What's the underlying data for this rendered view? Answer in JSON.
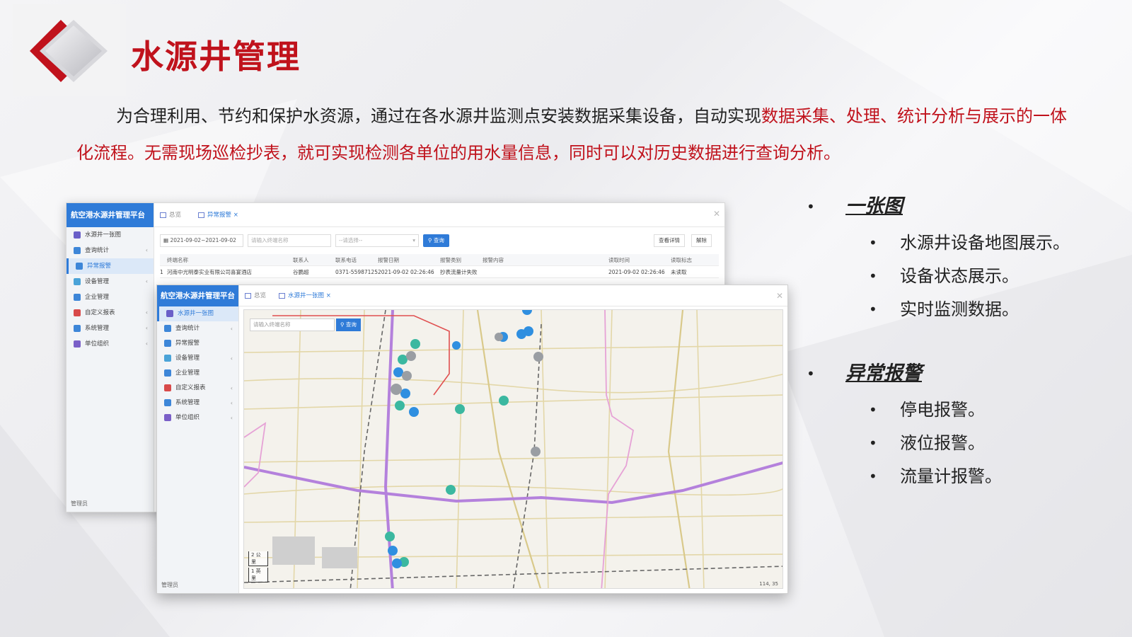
{
  "title": "水源井管理",
  "intro": {
    "plain": "为合理利用、节约和保护水资源，通过在各水源井监测点安装数据采集设备，自动实现",
    "highlight": "数据采集、处理、统计分析与展示的一体化流程。无需现场巡检抄表，就可实现检测各单位的用水量信息，同时可以对历史数据进行查询分析。"
  },
  "back_window": {
    "brand": "航空港水源井管理平台",
    "tabs": [
      "总览",
      "异常报警"
    ],
    "nav": [
      {
        "label": "水源井一张图",
        "chev": ""
      },
      {
        "label": "查询统计",
        "chev": "‹"
      },
      {
        "label": "异常报警",
        "chev": ""
      },
      {
        "label": "设备管理",
        "chev": "‹"
      },
      {
        "label": "企业管理",
        "chev": ""
      },
      {
        "label": "自定义报表",
        "chev": "‹"
      },
      {
        "label": "系统管理",
        "chev": "‹"
      },
      {
        "label": "单位组织",
        "chev": "‹"
      }
    ],
    "footer": "管理员",
    "toolbar": {
      "date_range": "2021-09-02~2021-09-02",
      "name_placeholder": "请输入终端名称",
      "select_placeholder": "--请选择--",
      "query": "查询",
      "detail": "查看详情",
      "release": "解除"
    },
    "table": {
      "headers": [
        "终端名称",
        "联系人",
        "联系电话",
        "报警日期",
        "报警类别",
        "报警内容",
        "读取时间",
        "读取标志"
      ],
      "rows": [
        [
          "1",
          "河南中光明泰实业有限公司喜宴酒店",
          "谷鹏超",
          "0371-55987125",
          "2021-09-02 02:26:46",
          "抄表流量计失败",
          "",
          "2021-09-02 02:26:46",
          "未读取"
        ]
      ]
    }
  },
  "front_window": {
    "brand": "航空港水源井管理平台",
    "tabs": [
      "总览",
      "水源井一张图"
    ],
    "nav": [
      {
        "label": "水源井一张图",
        "chev": ""
      },
      {
        "label": "查询统计",
        "chev": "‹"
      },
      {
        "label": "异常报警",
        "chev": ""
      },
      {
        "label": "设备管理",
        "chev": "‹"
      },
      {
        "label": "企业管理",
        "chev": ""
      },
      {
        "label": "自定义报表",
        "chev": "‹"
      },
      {
        "label": "系统管理",
        "chev": "‹"
      },
      {
        "label": "单位组织",
        "chev": "‹"
      }
    ],
    "footer": "管理员",
    "map": {
      "search_placeholder": "请输入终端名称",
      "query": "查询",
      "scale_1": "2 公里",
      "scale_2": "1 英里",
      "coord": "114, 35"
    }
  },
  "features": [
    {
      "title": "一张图",
      "items": [
        "水源井设备地图展示。",
        "设备状态展示。",
        "实时监测数据。"
      ]
    },
    {
      "title": "异常报警",
      "items": [
        "停电报警。",
        "液位报警。",
        "流量计报警。"
      ]
    }
  ],
  "colors": {
    "accent_red": "#c0121c",
    "brand_blue": "#2f7bd8",
    "marker_teal": "#3bb8a0",
    "marker_blue": "#2f8fe0",
    "marker_gray": "#9a9ea3"
  }
}
